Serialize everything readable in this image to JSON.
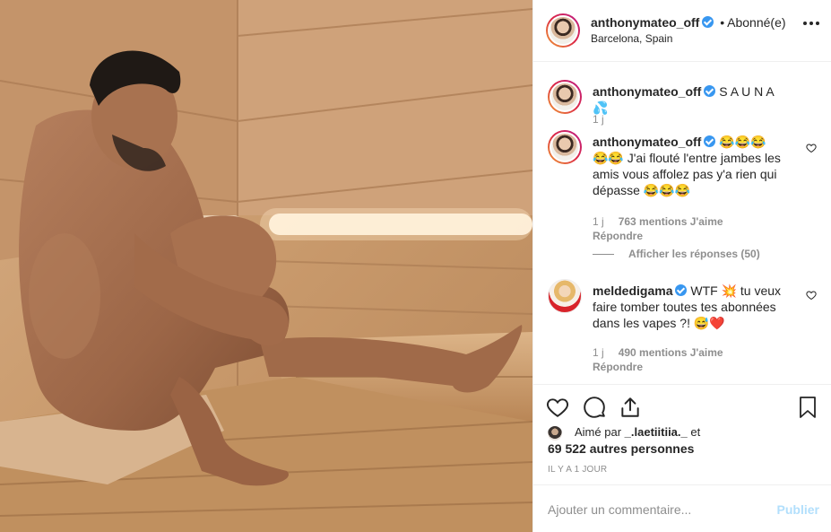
{
  "header": {
    "username": "anthonymateo_off",
    "separator": "•",
    "follow_label": "Abonné(e)",
    "location": "Barcelona, Spain",
    "more_icon": "more-dots-icon"
  },
  "caption": {
    "username": "anthonymateo_off",
    "text": "S A U N A 💦",
    "time": "1 j"
  },
  "comments": [
    {
      "username": "anthonymateo_off",
      "text": "😂😂😂 😂😂 J'ai flouté l'entre jambes les amis vous affolez pas y'a rien qui dépasse 😂😂😂",
      "time": "1 j",
      "likes": "763 mentions J'aime",
      "reply_label": "Répondre",
      "view_replies": "Afficher les réponses (50)"
    },
    {
      "username": "meldedigama",
      "text": "WTF 💥 tu veux faire tomber toutes tes abonnées dans les vapes ?! 😅❤️",
      "time": "1 j",
      "likes": "490 mentions J'aime",
      "reply_label": "Répondre"
    }
  ],
  "actions": {
    "icons": [
      "heart-icon",
      "comment-icon",
      "share-icon",
      "bookmark-icon"
    ]
  },
  "likes": {
    "prefix": "Aimé par",
    "first_user": "_.laetiitiia._",
    "conjunction": "et",
    "others": "69 522 autres personnes"
  },
  "timestamp": "IL Y A 1 JOUR",
  "add_comment": {
    "placeholder": "Ajouter un commentaire...",
    "post_label": "Publier"
  },
  "colors": {
    "verified": "#3897f0",
    "muted": "#8e8e8e",
    "post_disabled": "#b2dffc",
    "sauna_wood": "#c99c70"
  }
}
